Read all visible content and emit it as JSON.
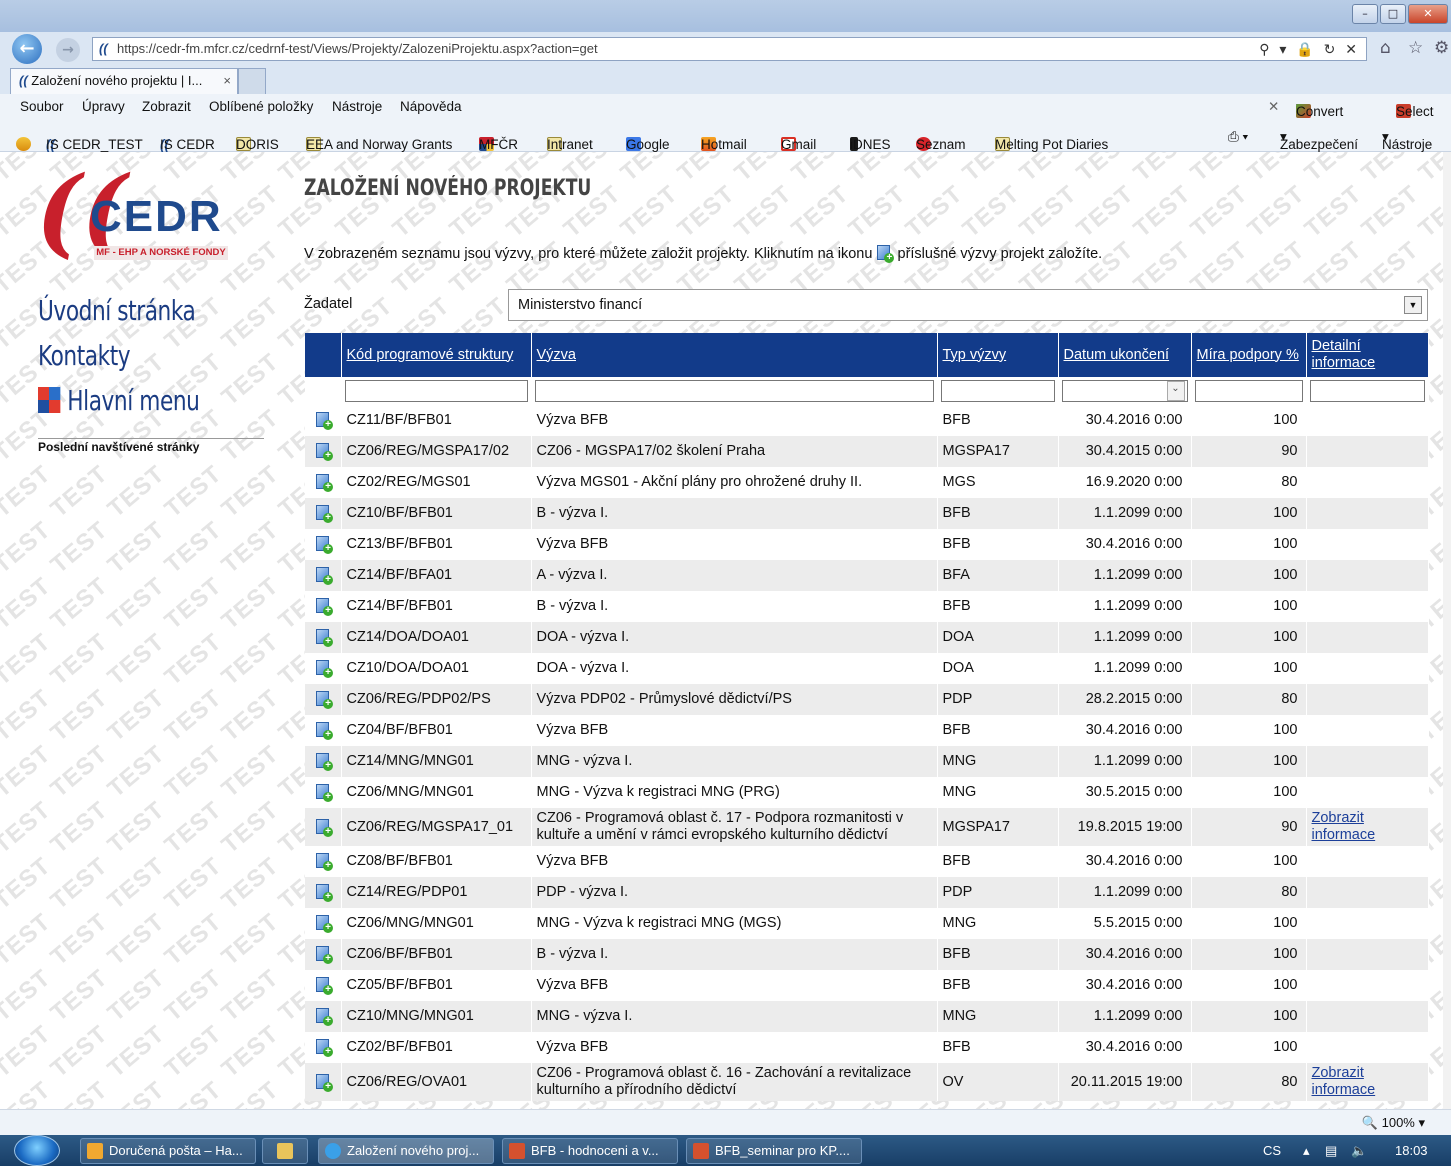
{
  "browser": {
    "url": "https://cedr-fm.mfcr.cz/cedrnf-test/Views/Projekty/ZalozeniProjektu.aspx?action=get",
    "tab_title": "Založení nového projektu | I...",
    "tab_close": "×",
    "menu": [
      "Soubor",
      "Úpravy",
      "Zobrazit",
      "Oblíbené položky",
      "Nástroje",
      "Nápověda"
    ],
    "menu_right": {
      "convert": "Convert",
      "select": "Select"
    },
    "favorites": [
      "IS CEDR_TEST",
      "IS CEDR",
      "DORIS",
      "EEA and Norway Grants",
      "MFČR",
      "Intranet",
      "Google",
      "Hotmail",
      "Gmail",
      "iDNES",
      "Seznam",
      "Melting Pot Diaries"
    ],
    "fav_right": {
      "security": "Zabezpečení",
      "tools": "Nástroje"
    }
  },
  "logo": {
    "text": "CEDR",
    "subtitle": "MF - EHP A NORSKÉ FONDY"
  },
  "sidebar": {
    "nav": [
      "Úvodní stránka",
      "Kontakty",
      "Hlavní menu"
    ],
    "recent_label": "Poslední navštívené stránky"
  },
  "page": {
    "title": "ZALOŽENÍ NOVÉHO PROJEKTU",
    "intro_before": "V zobrazeném seznamu jsou výzvy, pro které můžete založit projekty. Kliknutím na ikonu",
    "intro_after": "příslušné výzvy projekt založíte.",
    "applicant_label": "Žadatel",
    "applicant_value": "Ministerstvo financí"
  },
  "table": {
    "headers": [
      "Kód programové struktury",
      "Výzva",
      "Typ výzvy",
      "Datum ukončení",
      "Míra podpory %",
      "Detailní informace"
    ],
    "rows": [
      {
        "code": "CZ11/BF/BFB01",
        "call": "Výzva BFB",
        "type": "BFB",
        "date": "30.4.2016 0:00",
        "rate": "100",
        "info": ""
      },
      {
        "code": "CZ06/REG/MGSPA17/02",
        "call": "CZ06 - MGSPA17/02 školení Praha",
        "type": "MGSPA17",
        "date": "30.4.2015 0:00",
        "rate": "90",
        "info": ""
      },
      {
        "code": "CZ02/REG/MGS01",
        "call": "Výzva MGS01 - Akční plány pro ohrožené druhy II.",
        "type": "MGS",
        "date": "16.9.2020 0:00",
        "rate": "80",
        "info": ""
      },
      {
        "code": "CZ10/BF/BFB01",
        "call": "B - výzva I.",
        "type": "BFB",
        "date": "1.1.2099 0:00",
        "rate": "100",
        "info": ""
      },
      {
        "code": "CZ13/BF/BFB01",
        "call": "Výzva BFB",
        "type": "BFB",
        "date": "30.4.2016 0:00",
        "rate": "100",
        "info": ""
      },
      {
        "code": "CZ14/BF/BFA01",
        "call": "A - výzva I.",
        "type": "BFA",
        "date": "1.1.2099 0:00",
        "rate": "100",
        "info": ""
      },
      {
        "code": "CZ14/BF/BFB01",
        "call": "B - výzva I.",
        "type": "BFB",
        "date": "1.1.2099 0:00",
        "rate": "100",
        "info": ""
      },
      {
        "code": "CZ14/DOA/DOA01",
        "call": "DOA - výzva I.",
        "type": "DOA",
        "date": "1.1.2099 0:00",
        "rate": "100",
        "info": ""
      },
      {
        "code": "CZ10/DOA/DOA01",
        "call": "DOA - výzva I.",
        "type": "DOA",
        "date": "1.1.2099 0:00",
        "rate": "100",
        "info": ""
      },
      {
        "code": "CZ06/REG/PDP02/PS",
        "call": "Výzva PDP02 - Průmyslové dědictví/PS",
        "type": "PDP",
        "date": "28.2.2015 0:00",
        "rate": "80",
        "info": ""
      },
      {
        "code": "CZ04/BF/BFB01",
        "call": "Výzva BFB",
        "type": "BFB",
        "date": "30.4.2016 0:00",
        "rate": "100",
        "info": ""
      },
      {
        "code": "CZ14/MNG/MNG01",
        "call": "MNG - výzva I.",
        "type": "MNG",
        "date": "1.1.2099 0:00",
        "rate": "100",
        "info": ""
      },
      {
        "code": "CZ06/MNG/MNG01",
        "call": "MNG - Výzva k registraci MNG (PRG)",
        "type": "MNG",
        "date": "30.5.2015 0:00",
        "rate": "100",
        "info": ""
      },
      {
        "code": "CZ06/REG/MGSPA17_01",
        "call": "CZ06 - Programová oblast č. 17 - Podpora rozmanitosti v kultuře a umění v rámci evropského kulturního dědictví",
        "type": "MGSPA17",
        "date": "19.8.2015 19:00",
        "rate": "90",
        "info": "Zobrazit informace"
      },
      {
        "code": "CZ08/BF/BFB01",
        "call": "Výzva BFB",
        "type": "BFB",
        "date": "30.4.2016 0:00",
        "rate": "100",
        "info": ""
      },
      {
        "code": "CZ14/REG/PDP01",
        "call": "PDP - výzva I.",
        "type": "PDP",
        "date": "1.1.2099 0:00",
        "rate": "80",
        "info": ""
      },
      {
        "code": "CZ06/MNG/MNG01",
        "call": "MNG - Výzva k registraci MNG (MGS)",
        "type": "MNG",
        "date": "5.5.2015 0:00",
        "rate": "100",
        "info": ""
      },
      {
        "code": "CZ06/BF/BFB01",
        "call": "B - výzva I.",
        "type": "BFB",
        "date": "30.4.2016 0:00",
        "rate": "100",
        "info": ""
      },
      {
        "code": "CZ05/BF/BFB01",
        "call": "Výzva BFB",
        "type": "BFB",
        "date": "30.4.2016 0:00",
        "rate": "100",
        "info": ""
      },
      {
        "code": "CZ10/MNG/MNG01",
        "call": "MNG - výzva I.",
        "type": "MNG",
        "date": "1.1.2099 0:00",
        "rate": "100",
        "info": ""
      },
      {
        "code": "CZ02/BF/BFB01",
        "call": "Výzva BFB",
        "type": "BFB",
        "date": "30.4.2016 0:00",
        "rate": "100",
        "info": ""
      },
      {
        "code": "CZ06/REG/OVA01",
        "call": "CZ06 - Programová oblast č. 16 - Zachování a revitalizace kulturního a přírodního dědictví",
        "type": "OV",
        "date": "20.11.2015 19:00",
        "rate": "80",
        "info": "Zobrazit informace"
      }
    ]
  },
  "statusbar": {
    "zoom": "100%"
  },
  "taskbar": {
    "items": [
      "Doručená pošta – Ha...",
      "",
      "Založení nového proj...",
      "BFB - hodnoceni a v...",
      "BFB_seminar pro KP...."
    ],
    "lang": "CS",
    "time": "18:03"
  },
  "colors": {
    "header_blue": "#123b8a",
    "brand_red": "#c8202c",
    "brand_blue": "#1f4a8d",
    "nav_blue": "#1b3c82"
  }
}
